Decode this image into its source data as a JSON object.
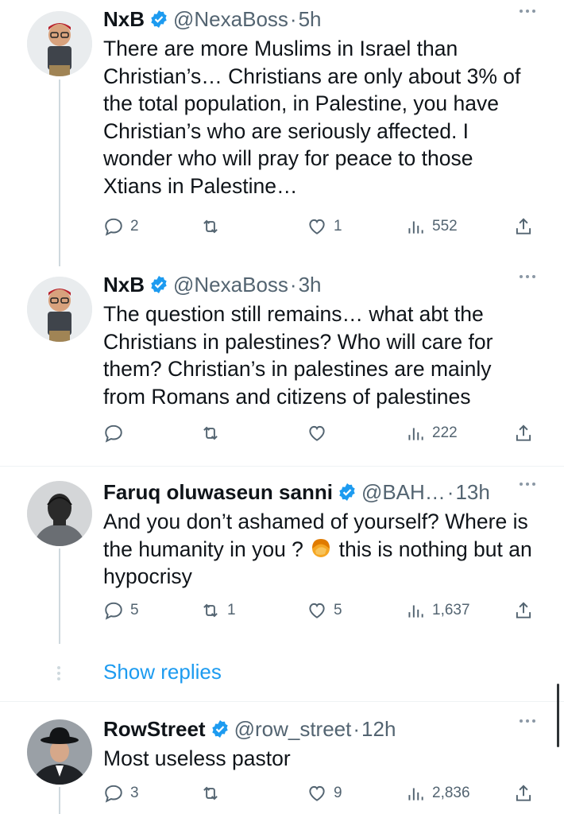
{
  "tweets": [
    {
      "name": "NxB",
      "handle": "@NexaBoss",
      "time": "5h",
      "text": "There are more Muslims in Israel than Christian’s… Christians are only about 3% of the total population, in Palestine, you have Christian’s who are seriously affected. I wonder who will pray for peace to those Xtians in Palestine…",
      "replies": "2",
      "retweets": "",
      "likes": "1",
      "views": "552"
    },
    {
      "name": "NxB",
      "handle": "@NexaBoss",
      "time": "3h",
      "text": "The question still remains… what abt the Christians in palestines? Who will care for them? Christian’s in palestines are mainly from Romans and citizens of palestines",
      "replies": "",
      "retweets": "",
      "likes": "",
      "views": "222"
    },
    {
      "name": "Faruq oluwaseun sanni",
      "handle": "@BAH…",
      "time": "13h",
      "text_part1": "And you don’t ashamed of yourself? Where is the humanity in you ? ",
      "emoji": "woman-facepalming-emoji",
      "text_part2": " this is nothing but an hypocrisy",
      "replies": "5",
      "retweets": "1",
      "likes": "5",
      "views": "1,637"
    },
    {
      "name": "RowStreet",
      "handle": "@row_street",
      "time": "12h",
      "text": "Most useless pastor",
      "replies": "3",
      "retweets": "",
      "likes": "9",
      "views": "2,836"
    }
  ],
  "separator": "·",
  "show_replies": "Show replies",
  "colors": {
    "text": "#0f1419",
    "muted": "#536471",
    "link": "#1d9bf0",
    "badge": "#1d9bf0",
    "line": "#cfd9de"
  },
  "icons": [
    "reply-icon",
    "retweet-icon",
    "like-icon",
    "views-icon",
    "share-icon",
    "verified-badge-icon",
    "more-icon"
  ]
}
